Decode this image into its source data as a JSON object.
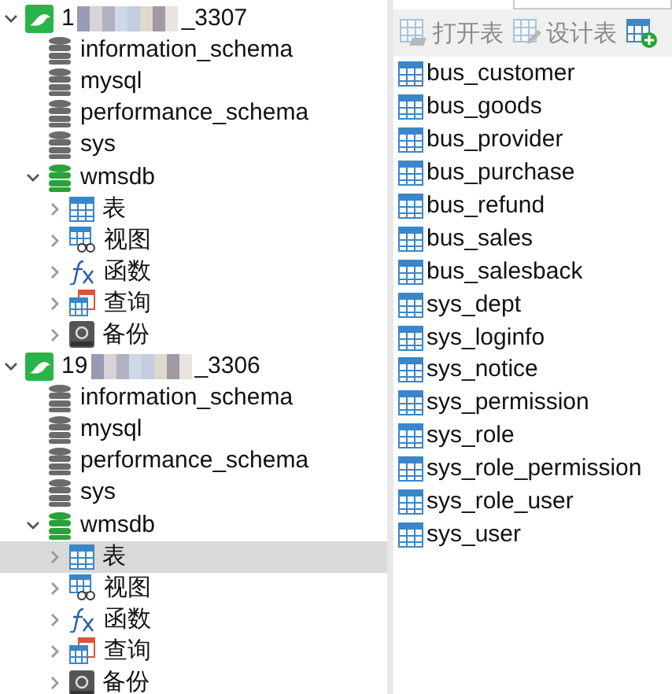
{
  "tree": [
    {
      "kind": "connection",
      "prefix": "1",
      "suffix": "_3307",
      "expanded": true,
      "children": [
        {
          "kind": "database",
          "name": "information_schema",
          "open": false
        },
        {
          "kind": "database",
          "name": "mysql",
          "open": false
        },
        {
          "kind": "database",
          "name": "performance_schema",
          "open": false
        },
        {
          "kind": "database",
          "name": "sys",
          "open": false
        },
        {
          "kind": "database",
          "name": "wmsdb",
          "open": true,
          "expanded": true,
          "children": [
            {
              "kind": "tables",
              "name": "表",
              "expanded": false,
              "selected": false
            },
            {
              "kind": "views",
              "name": "视图",
              "expanded": false,
              "selected": false
            },
            {
              "kind": "functions",
              "name": "函数",
              "expanded": false,
              "selected": false
            },
            {
              "kind": "queries",
              "name": "查询",
              "expanded": false,
              "selected": false
            },
            {
              "kind": "backups",
              "name": "备份",
              "expanded": false,
              "selected": false
            }
          ]
        }
      ]
    },
    {
      "kind": "connection",
      "prefix": "19",
      "suffix": "_3306",
      "expanded": true,
      "children": [
        {
          "kind": "database",
          "name": "information_schema",
          "open": false
        },
        {
          "kind": "database",
          "name": "mysql",
          "open": false
        },
        {
          "kind": "database",
          "name": "performance_schema",
          "open": false
        },
        {
          "kind": "database",
          "name": "sys",
          "open": false
        },
        {
          "kind": "database",
          "name": "wmsdb",
          "open": true,
          "expanded": true,
          "children": [
            {
              "kind": "tables",
              "name": "表",
              "expanded": false,
              "selected": true
            },
            {
              "kind": "views",
              "name": "视图",
              "expanded": false,
              "selected": false
            },
            {
              "kind": "functions",
              "name": "函数",
              "expanded": false,
              "selected": false
            },
            {
              "kind": "queries",
              "name": "查询",
              "expanded": false,
              "selected": false
            },
            {
              "kind": "backups",
              "name": "备份",
              "expanded": false,
              "selected": false
            }
          ]
        }
      ]
    }
  ],
  "toolbar": [
    {
      "kind": "open",
      "label": "打开表",
      "disabled": true
    },
    {
      "kind": "design",
      "label": "设计表",
      "disabled": true
    },
    {
      "kind": "new",
      "disabled": false
    }
  ],
  "tables": [
    "bus_customer",
    "bus_goods",
    "bus_provider",
    "bus_purchase",
    "bus_refund",
    "bus_sales",
    "bus_salesback",
    "sys_dept",
    "sys_loginfo",
    "sys_notice",
    "sys_permission",
    "sys_role",
    "sys_role_permission",
    "sys_role_user",
    "sys_user"
  ]
}
